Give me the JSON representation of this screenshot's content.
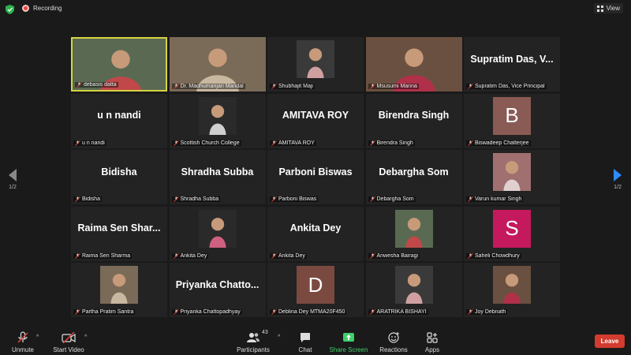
{
  "topbar": {
    "recording_label": "Recording",
    "view_label": "View"
  },
  "pager": {
    "left": "1/2",
    "right": "1/2"
  },
  "tiles": [
    {
      "label": "debasis datta",
      "kind": "video",
      "active": true
    },
    {
      "label": "Dr. Madhumanjari Mandal",
      "kind": "video"
    },
    {
      "label": "Shubhajit Maji",
      "kind": "photo"
    },
    {
      "label": "Msusumi Manna",
      "kind": "video"
    },
    {
      "label": "Supratim Das, Vice Principal",
      "kind": "name",
      "display": "Supratim Das, V..."
    },
    {
      "label": "u n nandi",
      "kind": "name",
      "display": "u n nandi"
    },
    {
      "label": "Scottish Church College",
      "kind": "photo"
    },
    {
      "label": "AMITAVA ROY",
      "kind": "name",
      "display": "AMITAVA ROY"
    },
    {
      "label": "Birendra Singh",
      "kind": "name",
      "display": "Birendra Singh"
    },
    {
      "label": "Biswadeep Chatterjee",
      "kind": "letter",
      "letter": "B",
      "color": "#8a5a54"
    },
    {
      "label": "Bidisha",
      "kind": "name",
      "display": "Bidisha"
    },
    {
      "label": "Shradha Subba",
      "kind": "name",
      "display": "Shradha Subba"
    },
    {
      "label": "Parboni Biswas",
      "kind": "name",
      "display": "Parboni Biswas"
    },
    {
      "label": "Debargha Som",
      "kind": "name",
      "display": "Debargha Som"
    },
    {
      "label": "Varun kumar Singh",
      "kind": "photo"
    },
    {
      "label": "Raima Sen Sharma",
      "kind": "name",
      "display": "Raima Sen Shar..."
    },
    {
      "label": "Ankita Dey",
      "kind": "photo"
    },
    {
      "label": "Ankita Dey",
      "kind": "name",
      "display": "Ankita Dey"
    },
    {
      "label": "Anwesha Bairagi",
      "kind": "photo"
    },
    {
      "label": "Saheli Chowdhury",
      "kind": "letter",
      "letter": "S",
      "color": "#c4195d"
    },
    {
      "label": "Partha Pratim Santra",
      "kind": "photo"
    },
    {
      "label": "Priyanka Chattopadhyay",
      "kind": "name",
      "display": "Priyanka  Chatto..."
    },
    {
      "label": "Deblina Dey MTMA20F450",
      "kind": "letter",
      "letter": "D",
      "color": "#7a4a40"
    },
    {
      "label": "ARATRIKA BISHAYI",
      "kind": "photo"
    },
    {
      "label": "Joy Debnath",
      "kind": "photo"
    }
  ],
  "toolbar": {
    "unmute": "Unmute",
    "start_video": "Start Video",
    "participants": "Participants",
    "participants_count": "43",
    "chat": "Chat",
    "share_screen": "Share Screen",
    "reactions": "Reactions",
    "apps": "Apps",
    "leave": "Leave"
  },
  "colors": {
    "active_border": "#d6d343",
    "share_green": "#3fcf6b",
    "leave_red": "#d33b2f"
  }
}
